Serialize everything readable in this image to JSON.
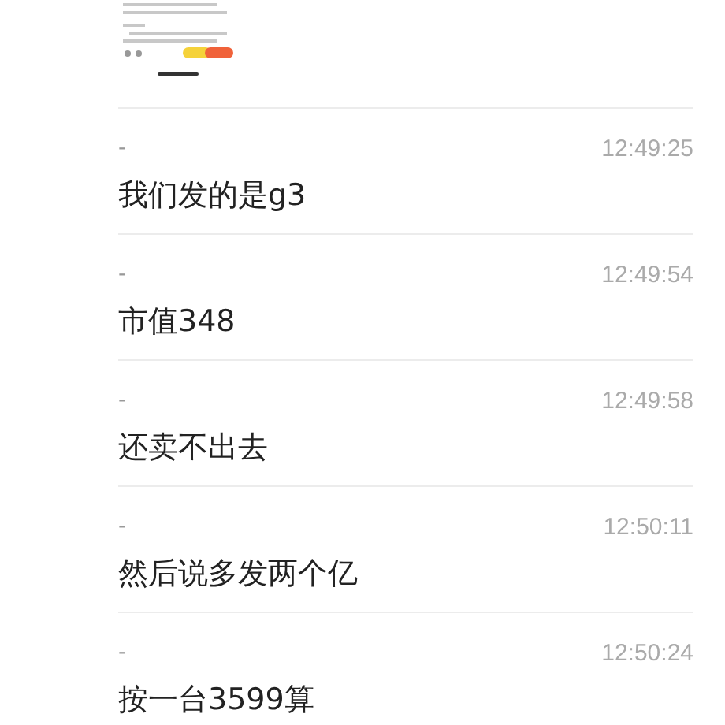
{
  "messages": [
    {
      "sender": "-",
      "time": "12:49:25",
      "text": "我们发的是g3"
    },
    {
      "sender": "-",
      "time": "12:49:54",
      "text": "市值348"
    },
    {
      "sender": "-",
      "time": "12:49:58",
      "text": "还卖不出去"
    },
    {
      "sender": "-",
      "time": "12:50:11",
      "text": "然后说多发两个亿"
    },
    {
      "sender": "-",
      "time": "12:50:24",
      "text": "按一台3599算"
    }
  ]
}
